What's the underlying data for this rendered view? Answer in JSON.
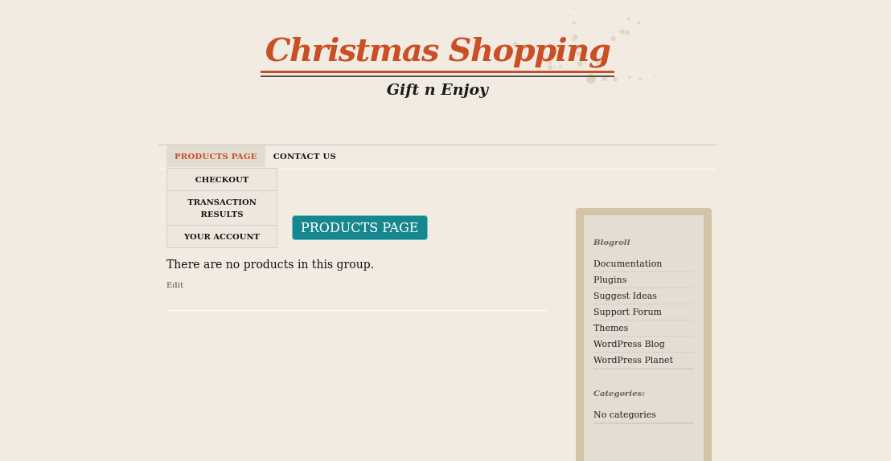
{
  "header": {
    "title": "Christmas Shopping",
    "tagline": "Gift n Enjoy"
  },
  "nav": {
    "items": [
      {
        "label": "PRODUCTS PAGE",
        "selected": true,
        "children": [
          {
            "label": "CHECKOUT"
          },
          {
            "label": "TRANSACTION RESULTS"
          },
          {
            "label": "YOUR ACCOUNT"
          }
        ]
      },
      {
        "label": "CONTACT US",
        "selected": false
      }
    ]
  },
  "main": {
    "button": "PRODUCTS PAGE",
    "message": "There are no products in this group.",
    "edit_link": "Edit"
  },
  "sidebar": {
    "widgets": [
      {
        "title": "Blogroll",
        "links": [
          "Documentation",
          "Plugins",
          "Suggest Ideas",
          "Support Forum",
          "Themes",
          "WordPress Blog",
          "WordPress Planet"
        ]
      },
      {
        "title": "Categories:",
        "links": [
          "No categories"
        ]
      }
    ]
  }
}
